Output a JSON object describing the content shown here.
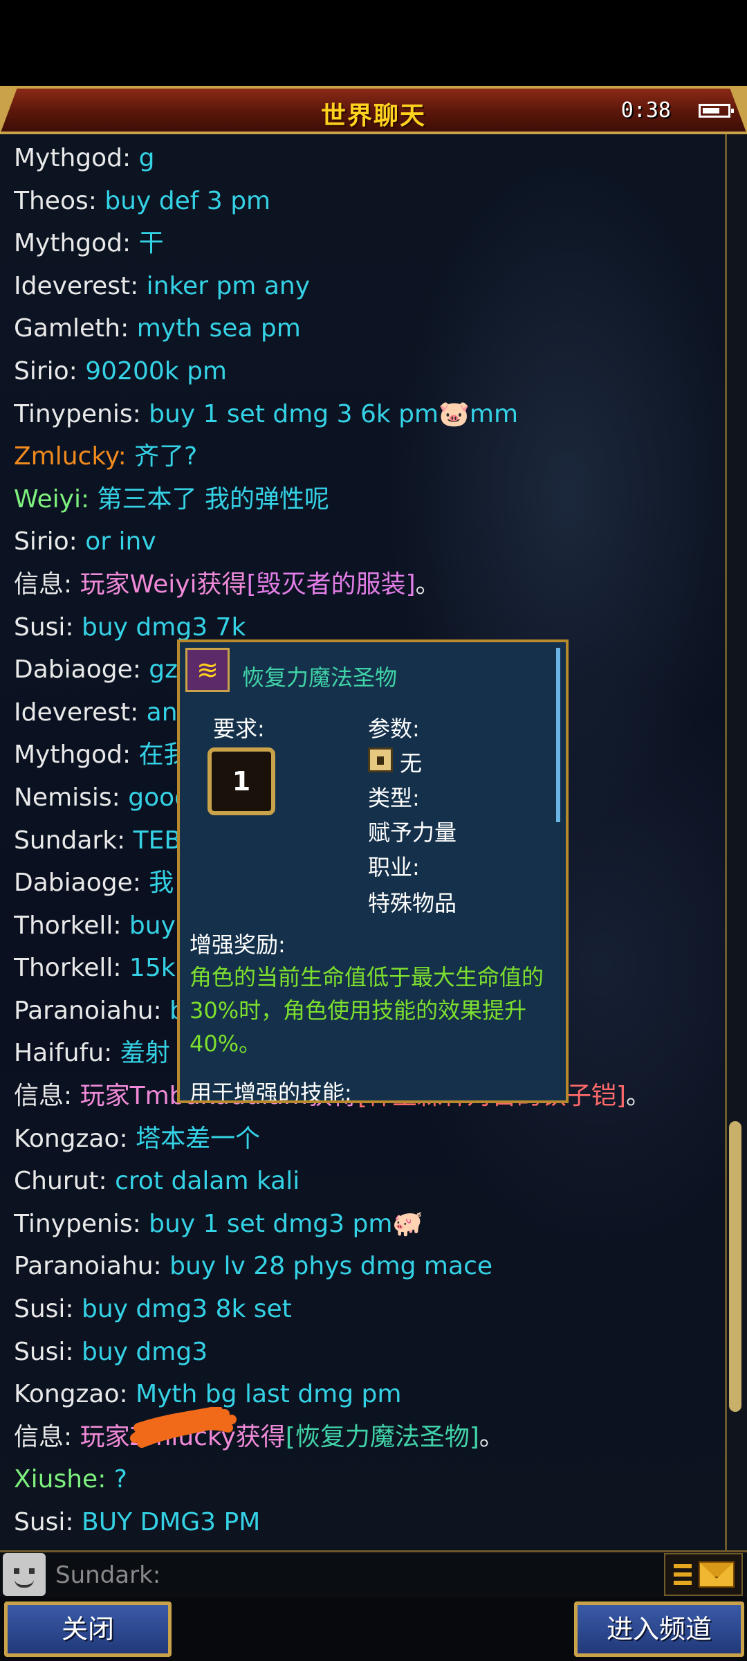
{
  "header": {
    "title": "世界聊天",
    "clock": "0:38"
  },
  "chat": {
    "lines": [
      {
        "name": "Mythgod:",
        "name_color": "#e9e9e9",
        "message": " g",
        "message_color": "#35d2e6"
      },
      {
        "name": "Theos:",
        "name_color": "#e9e9e9",
        "message": " buy def 3 pm",
        "message_color": "#35d2e6"
      },
      {
        "name": "Mythgod:",
        "name_color": "#e9e9e9",
        "message": " 干",
        "message_color": "#35d2e6"
      },
      {
        "name": "Ideverest:",
        "name_color": "#e9e9e9",
        "message": " inker pm any",
        "message_color": "#35d2e6"
      },
      {
        "name": "Gamleth:",
        "name_color": "#e9e9e9",
        "message": " myth sea pm",
        "message_color": "#35d2e6"
      },
      {
        "name": "Sirio:",
        "name_color": "#e9e9e9",
        "message": " 90200k pm",
        "message_color": "#35d2e6"
      },
      {
        "name": "Tinypenis:",
        "name_color": "#e9e9e9",
        "message": " buy 1 set dmg 3 6k pm🐷mm",
        "message_color": "#35d2e6"
      },
      {
        "name": "Zmlucky:",
        "name_color": "#f08a1e",
        "message": " 齐了?",
        "message_color": "#35d2e6"
      },
      {
        "name": "Weiyi:",
        "name_color": "#7ef07e",
        "message": " 第三本了 我的弹性呢",
        "message_color": "#35d2e6"
      },
      {
        "name": "Sirio:",
        "name_color": "#e9e9e9",
        "message": " or inv",
        "message_color": "#35d2e6"
      },
      {
        "name": "信息:",
        "name_color": "#e9e9e9",
        "message": " 玩家Weiyi获得",
        "message_color": "#f08ad8",
        "extra": "[毁灭者的服装]",
        "extra_color": "#e37ee8",
        "suffix": "。",
        "suffix_color": "#e9e9e9"
      },
      {
        "name": "Susi:",
        "name_color": "#e9e9e9",
        "message": " buy dmg3 7k",
        "message_color": "#35d2e6"
      },
      {
        "name": "Dabiaoge:",
        "name_color": "#e9e9e9",
        "message": " gz",
        "message_color": "#35d2e6"
      },
      {
        "name": "Ideverest:",
        "name_color": "#e9e9e9",
        "message": " any",
        "message_color": "#35d2e6"
      },
      {
        "name": "Mythgod:",
        "name_color": "#e9e9e9",
        "message": " 在我",
        "message_color": "#35d2e6"
      },
      {
        "name": "Nemisis:",
        "name_color": "#e9e9e9",
        "message": " good",
        "message_color": "#35d2e6"
      },
      {
        "name": "Sundark:",
        "name_color": "#e9e9e9",
        "message": " TEB",
        "message_color": "#35d2e6"
      },
      {
        "name": "Dabiaoge:",
        "name_color": "#e9e9e9",
        "message": " 我",
        "message_color": "#35d2e6"
      },
      {
        "name": "Thorkell:",
        "name_color": "#e9e9e9",
        "message": " buy",
        "message_color": "#35d2e6"
      },
      {
        "name": "Thorkell:",
        "name_color": "#e9e9e9",
        "message": " 15k",
        "message_color": "#35d2e6"
      },
      {
        "name": "Paranoiahu:",
        "name_color": "#e9e9e9",
        "message": " b",
        "message_color": "#35d2e6"
      },
      {
        "name": "Haifufu:",
        "name_color": "#e9e9e9",
        "message": " 羞射",
        "message_color": "#35d2e6"
      },
      {
        "name": "信息:",
        "name_color": "#e9e9e9",
        "message": " 玩家Tmbakudulam获得",
        "message_color": "#f08ad8",
        "extra": "[神圣森林对首的铁子铠]",
        "extra_color": "#ff6a6a",
        "suffix": "。",
        "suffix_color": "#e9e9e9"
      },
      {
        "name": "Kongzao:",
        "name_color": "#e9e9e9",
        "message": " 塔本差一个",
        "message_color": "#35d2e6"
      },
      {
        "name": "Churut:",
        "name_color": "#e9e9e9",
        "message": " crot dalam kali",
        "message_color": "#35d2e6"
      },
      {
        "name": "Tinypenis:",
        "name_color": "#e9e9e9",
        "message": " buy 1 set dmg3 pm🐖",
        "message_color": "#35d2e6"
      },
      {
        "name": "Paranoiahu:",
        "name_color": "#e9e9e9",
        "message": " buy lv 28 phys dmg mace",
        "message_color": "#35d2e6"
      },
      {
        "name": "Susi:",
        "name_color": "#e9e9e9",
        "message": " buy dmg3 8k set",
        "message_color": "#35d2e6"
      },
      {
        "name": "Susi:",
        "name_color": "#e9e9e9",
        "message": " buy dmg3",
        "message_color": "#35d2e6"
      },
      {
        "name": "Kongzao:",
        "name_color": "#e9e9e9",
        "message": " Myth bg last dmg pm",
        "message_color": "#35d2e6"
      },
      {
        "name": "信息:",
        "name_color": "#e9e9e9",
        "message": " 玩家Zmlucky获得",
        "message_color": "#f08ad8",
        "extra": "[恢复力魔法圣物]",
        "extra_color": "#41d3a8",
        "suffix": "。",
        "suffix_color": "#e9e9e9"
      },
      {
        "name": "Xiushe:",
        "name_color": "#7ef07e",
        "message": " ?",
        "message_color": "#35d2e6"
      },
      {
        "name": "Susi:",
        "name_color": "#e9e9e9",
        "message": " BUY DMG3 PM",
        "message_color": "#35d2e6"
      }
    ]
  },
  "tooltip": {
    "item_icon": "relic-icon",
    "item_name": "恢复力魔法圣物",
    "requirement_label": "要求:",
    "level": "1",
    "params_label": "参数:",
    "params_value": "无",
    "type_label": "类型:",
    "type_value": "赋予力量",
    "class_label": "职业:",
    "class_value": "特殊物品",
    "bonus_label": "增强奖励:",
    "bonus_text": "角色的当前生命值低于最大生命值的30%时，角色使用技能的效果提升40%。",
    "skill_label": "用于增强的技能:"
  },
  "input": {
    "text": "Sundark:"
  },
  "footer": {
    "close_label": "关闭",
    "enter_channel_label": "进入频道"
  },
  "colors": {
    "title_bar": "#6a1c0c",
    "gold_border": "#c9a24a",
    "title_text": "#ffd21f",
    "chat_bg": "#0c1422",
    "tooltip_bg": "#14304a",
    "bonus_text": "#7ee02e",
    "button_blue": "#2d4c96"
  }
}
